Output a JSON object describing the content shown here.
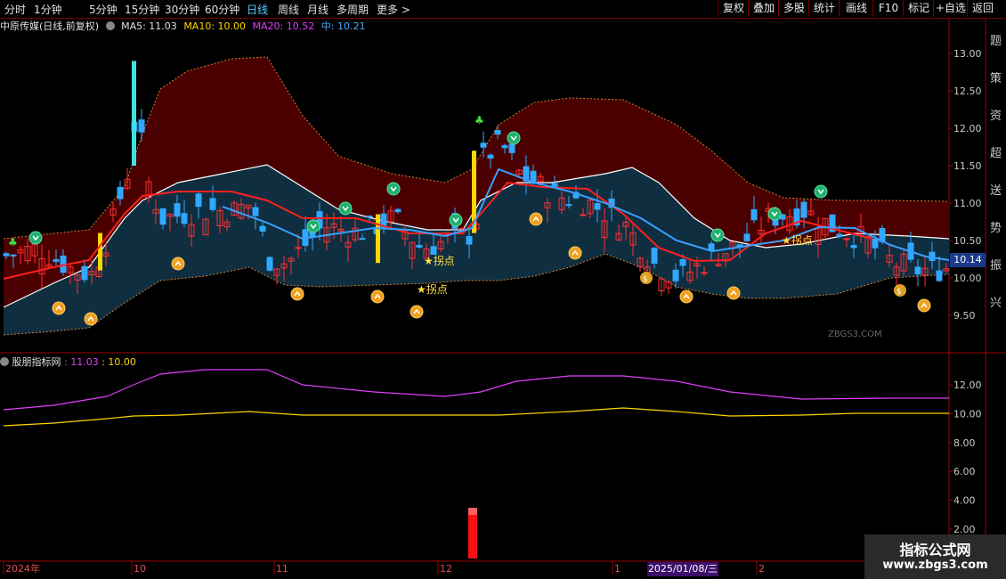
{
  "toolbar": {
    "periods": [
      "分时",
      "1分钟",
      "5分钟",
      "15分钟",
      "30分钟",
      "60分钟",
      "日线",
      "周线",
      "月线",
      "多周期",
      "更多 >"
    ],
    "active_period": "日线",
    "right_buttons": [
      "复权",
      "叠加",
      "多股",
      "统计",
      "画线",
      "F10",
      "标记",
      "+自选",
      "返回"
    ]
  },
  "main_legend": {
    "title": "中原传媒(日线,前复权)",
    "ma5": "MA5: 11.03",
    "ma10": "MA10: 10.00",
    "ma20": "MA20: 10.52",
    "mid": "中: 10.21",
    "colors": {
      "title": "#e0e0e0",
      "ma5": "#e0e0e0",
      "ma10": "#ffd700",
      "ma20": "#e040fb",
      "mid": "#4fa8ff"
    }
  },
  "sub_legend": {
    "title": "股朋指标网",
    "v1": ": 11.03",
    "v2": ": 10.00",
    "colors": {
      "v1": "#e040fb",
      "v2": "#ffd700"
    }
  },
  "price_axis": [
    "13.00",
    "12.50",
    "12.00",
    "11.50",
    "11.00",
    "10.50",
    "10.00",
    "9.50"
  ],
  "sub_axis": [
    "12.00",
    "10.00",
    "8.00",
    "6.00",
    "4.00",
    "2.00"
  ],
  "current_price": "10.14",
  "date_axis": [
    {
      "label": "2024年"
    },
    {
      "label": "10"
    },
    {
      "label": "11"
    },
    {
      "label": "12"
    },
    {
      "label": "1"
    },
    {
      "label": "2"
    }
  ],
  "highlight_date": "2025/01/08/三",
  "annotation_text": "★拐点",
  "chart_watermark": "ZBGS3.COM",
  "site_watermark": {
    "title": "指标公式网",
    "url": "www.zbgs3.com"
  },
  "right_edge_text": "题策资超送势振兴"
}
